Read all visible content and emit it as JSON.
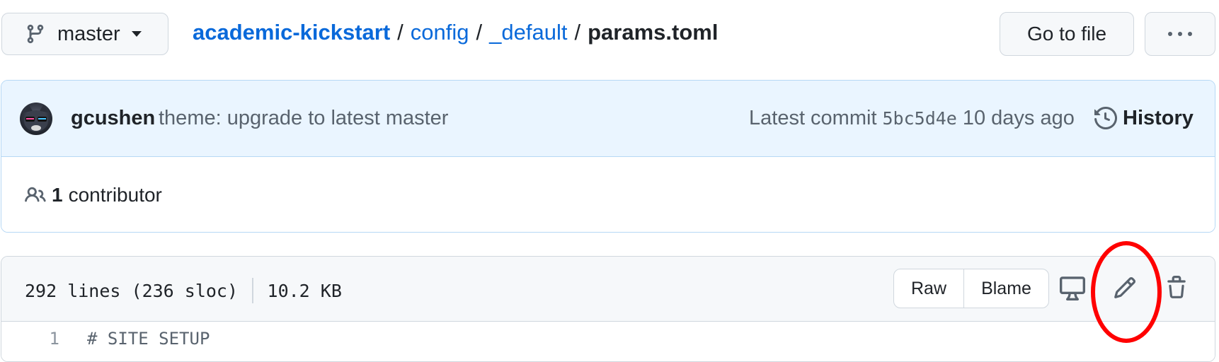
{
  "branch": {
    "name": "master",
    "icon": "git-branch-icon",
    "caret_icon": "triangle-down-icon"
  },
  "breadcrumb": {
    "repo": "academic-kickstart",
    "sep": "/",
    "dir1": "config",
    "dir2": "_default",
    "file": "params.toml"
  },
  "header_actions": {
    "go_to_file": "Go to file",
    "more_icon": "kebab-horizontal-icon"
  },
  "commit": {
    "author": "gcushen",
    "message": "theme: upgrade to latest master",
    "latest_label": "Latest commit",
    "sha": "5bc5d4e",
    "time_ago": "10 days ago",
    "history_label": "History",
    "history_icon": "history-icon"
  },
  "contributors": {
    "count": "1",
    "label": "contributor",
    "icon": "people-icon"
  },
  "file": {
    "lines_info": "292 lines (236 sloc)",
    "size": "10.2 KB",
    "raw_label": "Raw",
    "blame_label": "Blame",
    "icons": [
      "desktop-icon",
      "pencil-icon",
      "trash-icon"
    ]
  },
  "code": {
    "lines": [
      {
        "number": "1",
        "text": "# SITE SETUP"
      }
    ]
  },
  "colors": {
    "link": "#0969da",
    "annotation": "#ff0000",
    "commit_bg": "#eaf5ff",
    "header_bg": "#f6f8fa"
  }
}
